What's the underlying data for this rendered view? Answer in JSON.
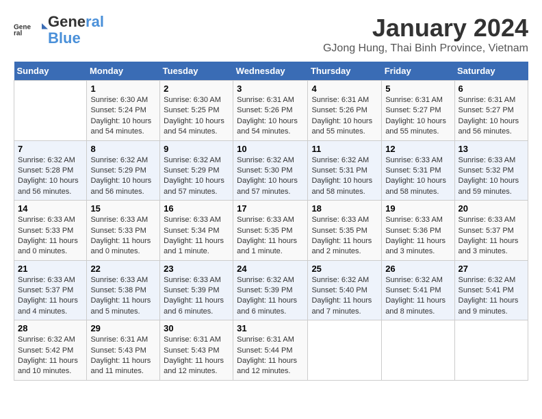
{
  "logo": {
    "line1": "General",
    "line2": "Blue"
  },
  "title": "January 2024",
  "subtitle": "GJong Hung, Thai Binh Province, Vietnam",
  "days_header": [
    "Sunday",
    "Monday",
    "Tuesday",
    "Wednesday",
    "Thursday",
    "Friday",
    "Saturday"
  ],
  "weeks": [
    [
      {
        "day": "",
        "info": ""
      },
      {
        "day": "1",
        "info": "Sunrise: 6:30 AM\nSunset: 5:24 PM\nDaylight: 10 hours\nand 54 minutes."
      },
      {
        "day": "2",
        "info": "Sunrise: 6:30 AM\nSunset: 5:25 PM\nDaylight: 10 hours\nand 54 minutes."
      },
      {
        "day": "3",
        "info": "Sunrise: 6:31 AM\nSunset: 5:26 PM\nDaylight: 10 hours\nand 54 minutes."
      },
      {
        "day": "4",
        "info": "Sunrise: 6:31 AM\nSunset: 5:26 PM\nDaylight: 10 hours\nand 55 minutes."
      },
      {
        "day": "5",
        "info": "Sunrise: 6:31 AM\nSunset: 5:27 PM\nDaylight: 10 hours\nand 55 minutes."
      },
      {
        "day": "6",
        "info": "Sunrise: 6:31 AM\nSunset: 5:27 PM\nDaylight: 10 hours\nand 56 minutes."
      }
    ],
    [
      {
        "day": "7",
        "info": "Sunrise: 6:32 AM\nSunset: 5:28 PM\nDaylight: 10 hours\nand 56 minutes."
      },
      {
        "day": "8",
        "info": "Sunrise: 6:32 AM\nSunset: 5:29 PM\nDaylight: 10 hours\nand 56 minutes."
      },
      {
        "day": "9",
        "info": "Sunrise: 6:32 AM\nSunset: 5:29 PM\nDaylight: 10 hours\nand 57 minutes."
      },
      {
        "day": "10",
        "info": "Sunrise: 6:32 AM\nSunset: 5:30 PM\nDaylight: 10 hours\nand 57 minutes."
      },
      {
        "day": "11",
        "info": "Sunrise: 6:32 AM\nSunset: 5:31 PM\nDaylight: 10 hours\nand 58 minutes."
      },
      {
        "day": "12",
        "info": "Sunrise: 6:33 AM\nSunset: 5:31 PM\nDaylight: 10 hours\nand 58 minutes."
      },
      {
        "day": "13",
        "info": "Sunrise: 6:33 AM\nSunset: 5:32 PM\nDaylight: 10 hours\nand 59 minutes."
      }
    ],
    [
      {
        "day": "14",
        "info": "Sunrise: 6:33 AM\nSunset: 5:33 PM\nDaylight: 11 hours\nand 0 minutes."
      },
      {
        "day": "15",
        "info": "Sunrise: 6:33 AM\nSunset: 5:33 PM\nDaylight: 11 hours\nand 0 minutes."
      },
      {
        "day": "16",
        "info": "Sunrise: 6:33 AM\nSunset: 5:34 PM\nDaylight: 11 hours\nand 1 minute."
      },
      {
        "day": "17",
        "info": "Sunrise: 6:33 AM\nSunset: 5:35 PM\nDaylight: 11 hours\nand 1 minute."
      },
      {
        "day": "18",
        "info": "Sunrise: 6:33 AM\nSunset: 5:35 PM\nDaylight: 11 hours\nand 2 minutes."
      },
      {
        "day": "19",
        "info": "Sunrise: 6:33 AM\nSunset: 5:36 PM\nDaylight: 11 hours\nand 3 minutes."
      },
      {
        "day": "20",
        "info": "Sunrise: 6:33 AM\nSunset: 5:37 PM\nDaylight: 11 hours\nand 3 minutes."
      }
    ],
    [
      {
        "day": "21",
        "info": "Sunrise: 6:33 AM\nSunset: 5:37 PM\nDaylight: 11 hours\nand 4 minutes."
      },
      {
        "day": "22",
        "info": "Sunrise: 6:33 AM\nSunset: 5:38 PM\nDaylight: 11 hours\nand 5 minutes."
      },
      {
        "day": "23",
        "info": "Sunrise: 6:33 AM\nSunset: 5:39 PM\nDaylight: 11 hours\nand 6 minutes."
      },
      {
        "day": "24",
        "info": "Sunrise: 6:32 AM\nSunset: 5:39 PM\nDaylight: 11 hours\nand 6 minutes."
      },
      {
        "day": "25",
        "info": "Sunrise: 6:32 AM\nSunset: 5:40 PM\nDaylight: 11 hours\nand 7 minutes."
      },
      {
        "day": "26",
        "info": "Sunrise: 6:32 AM\nSunset: 5:41 PM\nDaylight: 11 hours\nand 8 minutes."
      },
      {
        "day": "27",
        "info": "Sunrise: 6:32 AM\nSunset: 5:41 PM\nDaylight: 11 hours\nand 9 minutes."
      }
    ],
    [
      {
        "day": "28",
        "info": "Sunrise: 6:32 AM\nSunset: 5:42 PM\nDaylight: 11 hours\nand 10 minutes."
      },
      {
        "day": "29",
        "info": "Sunrise: 6:31 AM\nSunset: 5:43 PM\nDaylight: 11 hours\nand 11 minutes."
      },
      {
        "day": "30",
        "info": "Sunrise: 6:31 AM\nSunset: 5:43 PM\nDaylight: 11 hours\nand 12 minutes."
      },
      {
        "day": "31",
        "info": "Sunrise: 6:31 AM\nSunset: 5:44 PM\nDaylight: 11 hours\nand 12 minutes."
      },
      {
        "day": "",
        "info": ""
      },
      {
        "day": "",
        "info": ""
      },
      {
        "day": "",
        "info": ""
      }
    ]
  ]
}
